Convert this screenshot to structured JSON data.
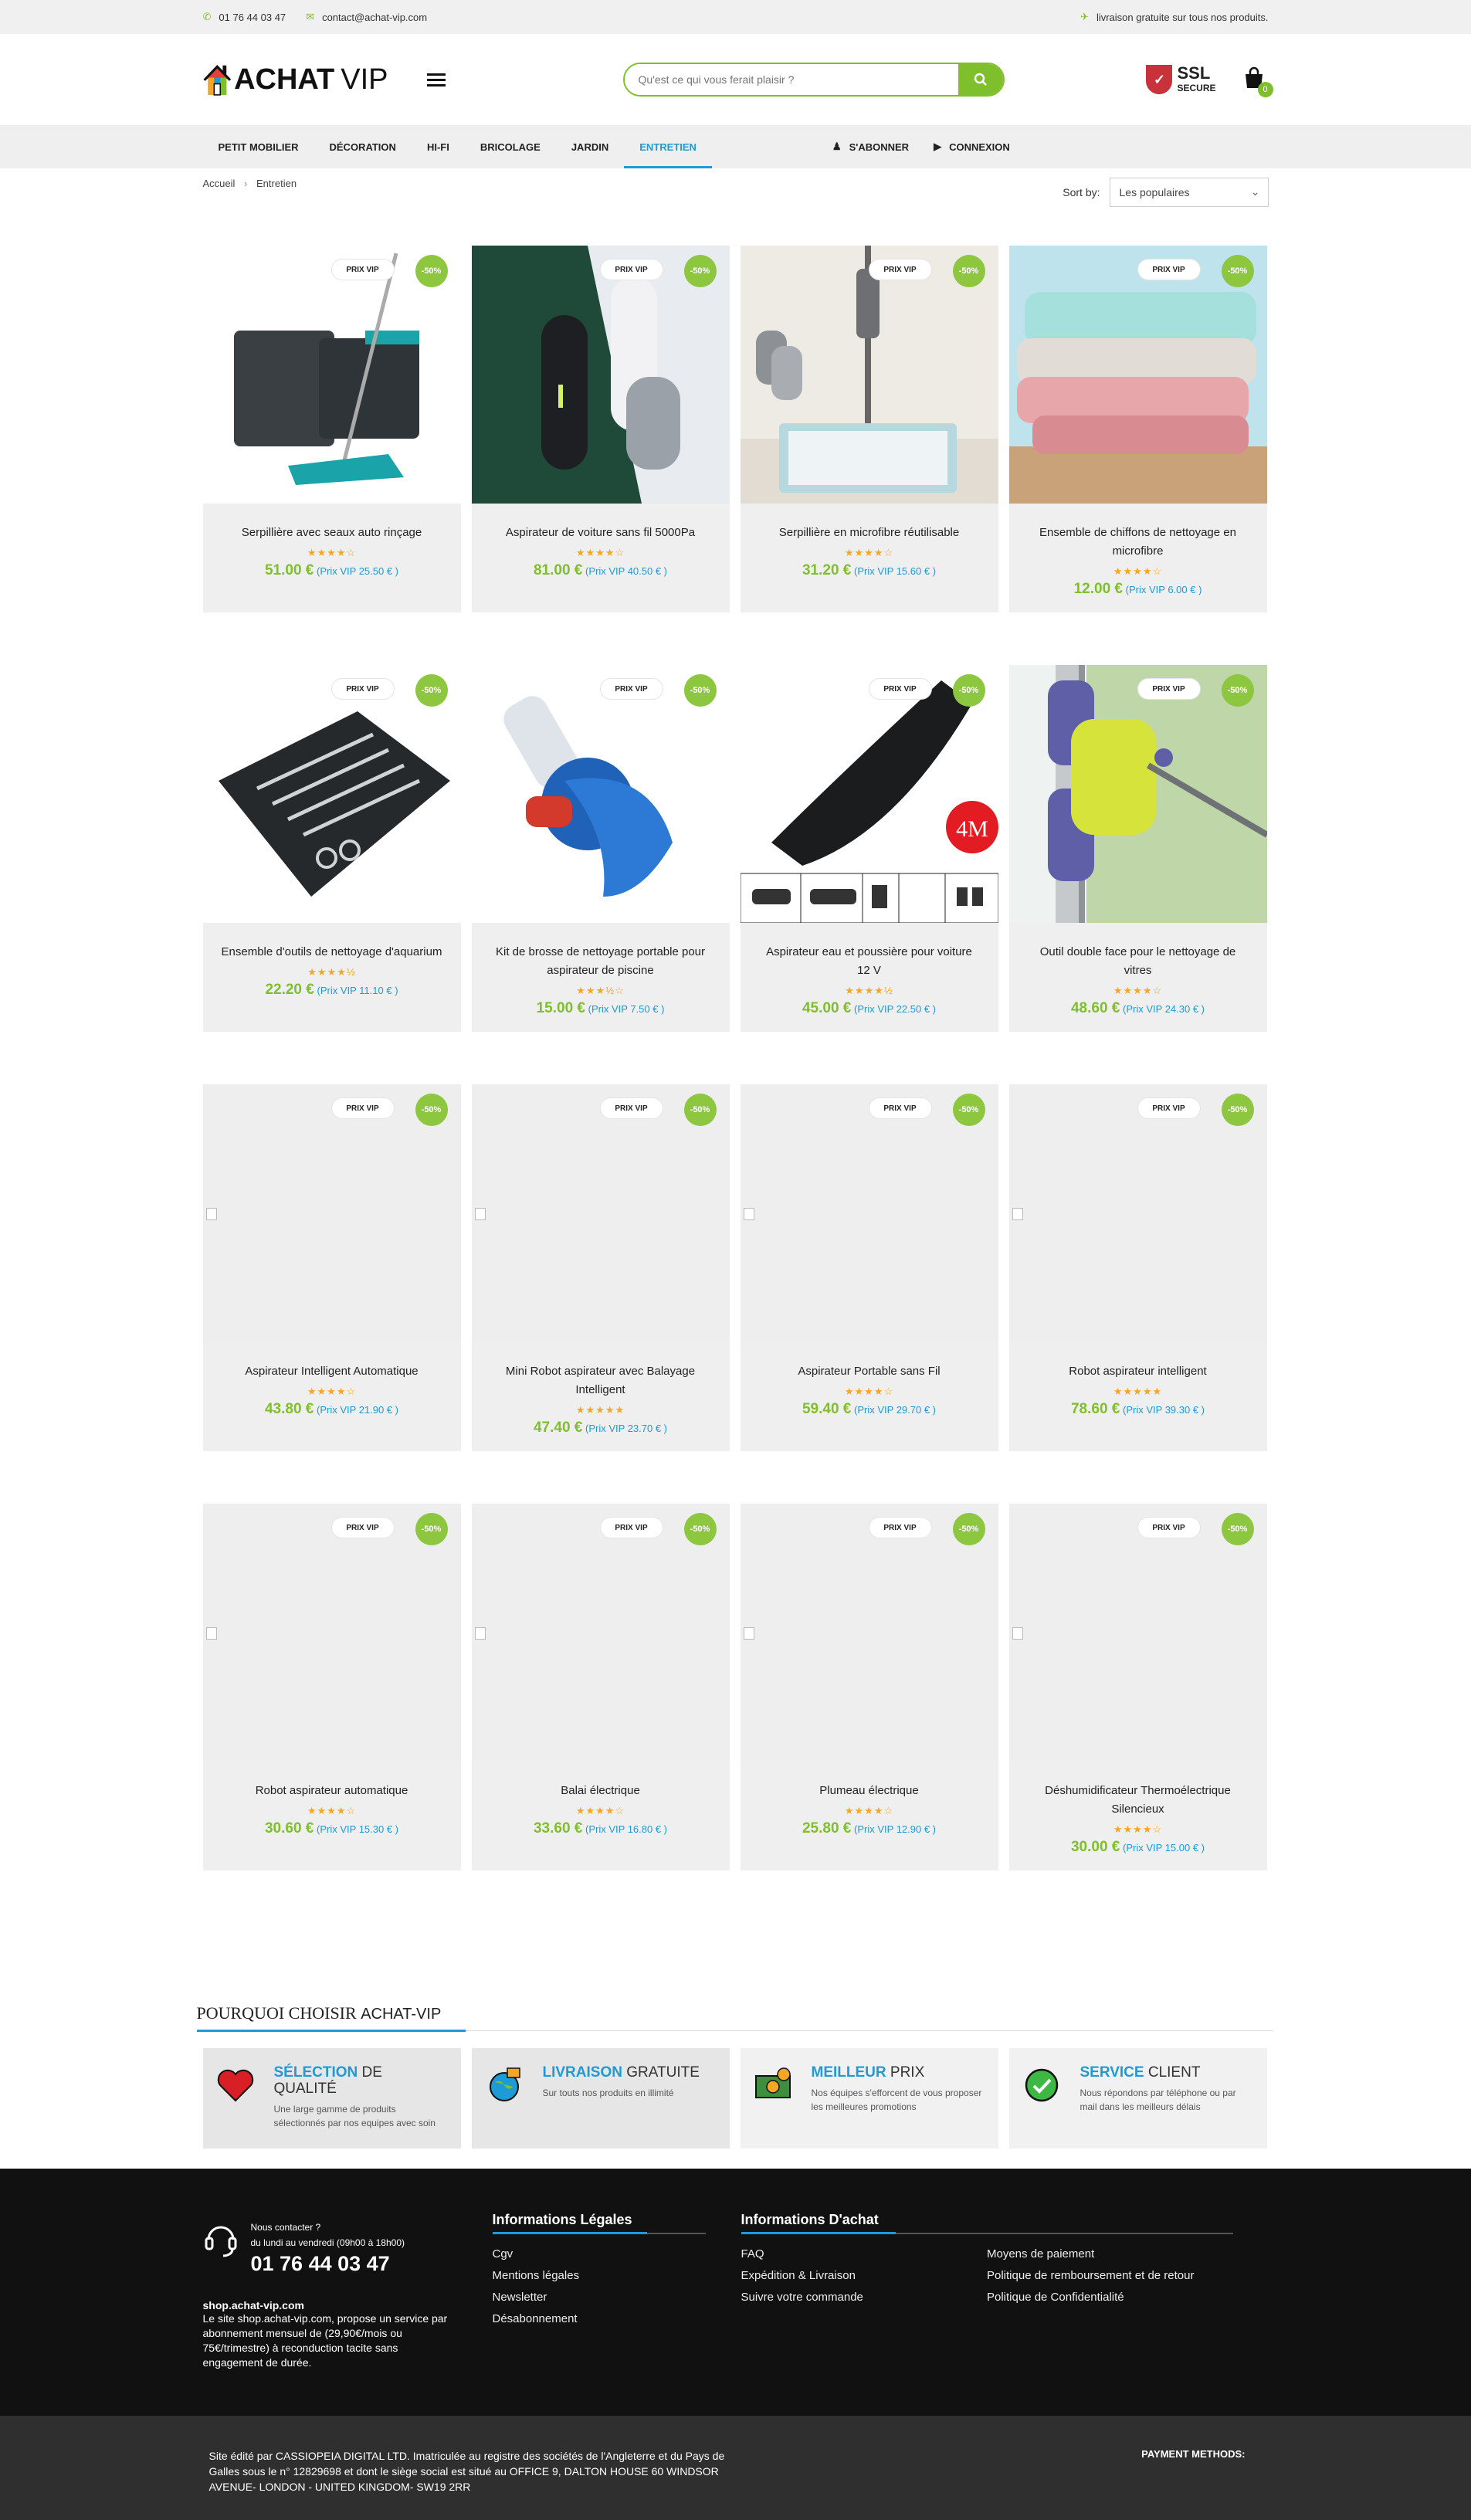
{
  "topbar": {
    "phone": "01 76 44 03 47",
    "email": "contact@achat-vip.com",
    "shipping": "livraison gratuite sur tous nos produits."
  },
  "header": {
    "logo_text": "ACHAT",
    "logo_text2": "VIP",
    "search_placeholder": "Qu'est ce qui vous ferait plaisir ?",
    "ssl_title": "SSL",
    "ssl_sub": "SECURE",
    "cart_count": "0"
  },
  "nav": {
    "items": [
      "PETIT MOBILIER",
      "DÉCORATION",
      "HI-FI",
      "BRICOLAGE",
      "JARDIN",
      "ENTRETIEN"
    ],
    "active_index": 5,
    "subscribe": "S'ABONNER",
    "login": "CONNEXION"
  },
  "breadcrumb": {
    "home": "Accueil",
    "sep": "›",
    "current": "Entretien"
  },
  "sort": {
    "label": "Sort by:",
    "value": "Les populaires"
  },
  "badges": {
    "vip": "PRIX VIP",
    "discount": "-50%"
  },
  "products": [
    {
      "name": "Serpillière avec seaux auto rinçage",
      "price": "51.00 €",
      "vip_label": "(Prix VIP",
      "vip_price": "25.50 € )",
      "stars": "★★★★☆",
      "img": "mop"
    },
    {
      "name": "Aspirateur de voiture sans fil 5000Pa",
      "price": "81.00 €",
      "vip_label": "(Prix VIP",
      "vip_price": "40.50 € )",
      "stars": "★★★★☆",
      "img": "carvac"
    },
    {
      "name": "Serpillière en microfibre réutilisable",
      "price": "31.20 €",
      "vip_label": "(Prix VIP",
      "vip_price": "15.60 € )",
      "stars": "★★★★☆",
      "img": "spraymop"
    },
    {
      "name": "Ensemble de chiffons de nettoyage en microfibre",
      "price": "12.00 €",
      "vip_label": "(Prix VIP",
      "vip_price": "6.00 € )",
      "stars": "★★★★☆",
      "img": "cloths"
    },
    {
      "name": "Ensemble d'outils de nettoyage d'aquarium",
      "price": "22.20 €",
      "vip_label": "(Prix VIP",
      "vip_price": "11.10 € )",
      "stars": "★★★★½",
      "img": "tools"
    },
    {
      "name": "Kit de brosse de nettoyage portable pour aspirateur de piscine",
      "price": "15.00 €",
      "vip_label": "(Prix VIP",
      "vip_price": "7.50 € )",
      "stars": "★★★½☆",
      "img": "brush"
    },
    {
      "name": "Aspirateur eau et poussière pour voiture 12 V",
      "price": "45.00 €",
      "vip_label": "(Prix VIP",
      "vip_price": "22.50 € )",
      "stars": "★★★★½",
      "img": "handvac"
    },
    {
      "name": "Outil double face pour le nettoyage de vitres",
      "price": "48.60 €",
      "vip_label": "(Prix VIP",
      "vip_price": "24.30 € )",
      "stars": "★★★★☆",
      "img": "window"
    },
    {
      "name": "Aspirateur Intelligent Automatique",
      "price": "43.80 €",
      "vip_label": "(Prix VIP",
      "vip_price": "21.90 € )",
      "stars": "★★★★☆",
      "img": ""
    },
    {
      "name": "Mini Robot aspirateur avec Balayage Intelligent",
      "price": "47.40 €",
      "vip_label": "(Prix VIP",
      "vip_price": "23.70 € )",
      "stars": "★★★★★",
      "img": ""
    },
    {
      "name": "Aspirateur Portable sans Fil",
      "price": "59.40 €",
      "vip_label": "(Prix VIP",
      "vip_price": "29.70 € )",
      "stars": "★★★★☆",
      "img": ""
    },
    {
      "name": "Robot aspirateur intelligent",
      "price": "78.60 €",
      "vip_label": "(Prix VIP",
      "vip_price": "39.30 € )",
      "stars": "★★★★★",
      "img": ""
    },
    {
      "name": "Robot aspirateur automatique",
      "price": "30.60 €",
      "vip_label": "(Prix VIP",
      "vip_price": "15.30 € )",
      "stars": "★★★★☆",
      "img": ""
    },
    {
      "name": "Balai électrique",
      "price": "33.60 €",
      "vip_label": "(Prix VIP",
      "vip_price": "16.80 € )",
      "stars": "★★★★☆",
      "img": ""
    },
    {
      "name": "Plumeau électrique",
      "price": "25.80 €",
      "vip_label": "(Prix VIP",
      "vip_price": "12.90 € )",
      "stars": "★★★★☆",
      "img": ""
    },
    {
      "name": "Déshumidificateur Thermoélectrique Silencieux",
      "price": "30.00 €",
      "vip_label": "(Prix VIP",
      "vip_price": "15.00 € )",
      "stars": "★★★★☆",
      "img": ""
    }
  ],
  "why": {
    "title_a": "POURQUOI CHOISIR",
    "title_b": "ACHAT-VIP",
    "boxes": [
      {
        "hl": "SÉLECTION",
        "rest": "DE QUALITÉ",
        "desc": "Une large gamme de produits sélectionnés par nos equipes avec soin",
        "icon": "heart-icon"
      },
      {
        "hl": "LIVRAISON",
        "rest": "GRATUITE",
        "desc": "Sur touts nos produits en illimité",
        "icon": "globe-icon"
      },
      {
        "hl": "MEILLEUR",
        "rest": "PRIX",
        "desc": "Nos équipes s'efforcent de vous proposer les meilleures promotions",
        "icon": "money-icon"
      },
      {
        "hl": "SERVICE",
        "rest": "CLIENT",
        "desc": "Nous répondons par téléphone ou par mail dans les meilleurs délais",
        "icon": "check-icon"
      }
    ]
  },
  "footer": {
    "contact_q": "Nous contacter ?",
    "hours": "du lundi au vendredi (09h00 à 18h00)",
    "phone": "01 76 44 03 47",
    "site": "shop.achat-vip.com",
    "desc": "Le site shop.achat-vip.com, propose un service par abonnement mensuel de (29,90€/mois ou 75€/trimestre) à reconduction tacite sans engagement de durée.",
    "legal_title": "Informations Légales",
    "legal_links": [
      "Cgv",
      "Mentions légales",
      "Newsletter",
      "Désabonnement"
    ],
    "buy_title": "Informations D'achat",
    "buy_links_a": [
      "FAQ",
      "Expédition & Livraison",
      "Suivre votre commande"
    ],
    "buy_links_b": [
      "Moyens de paiement",
      "Politique de remboursement et de retour",
      "Politique de Confidentialité"
    ],
    "company": "Site édité par CASSIOPEIA DIGITAL LTD. Imatriculée au registre des sociétés de l'Angleterre et du Pays de Galles sous le n° 12829698 et dont le siège social est situé au OFFICE 9, DALTON HOUSE 60 WINDSOR AVENUE- LONDON - UNITED KINGDOM- SW19 2RR",
    "payment": "PAYMENT METHODS:"
  },
  "colors": {
    "green": "#7fbf2b",
    "blue": "#1e9ad6",
    "footer": "#111111"
  }
}
